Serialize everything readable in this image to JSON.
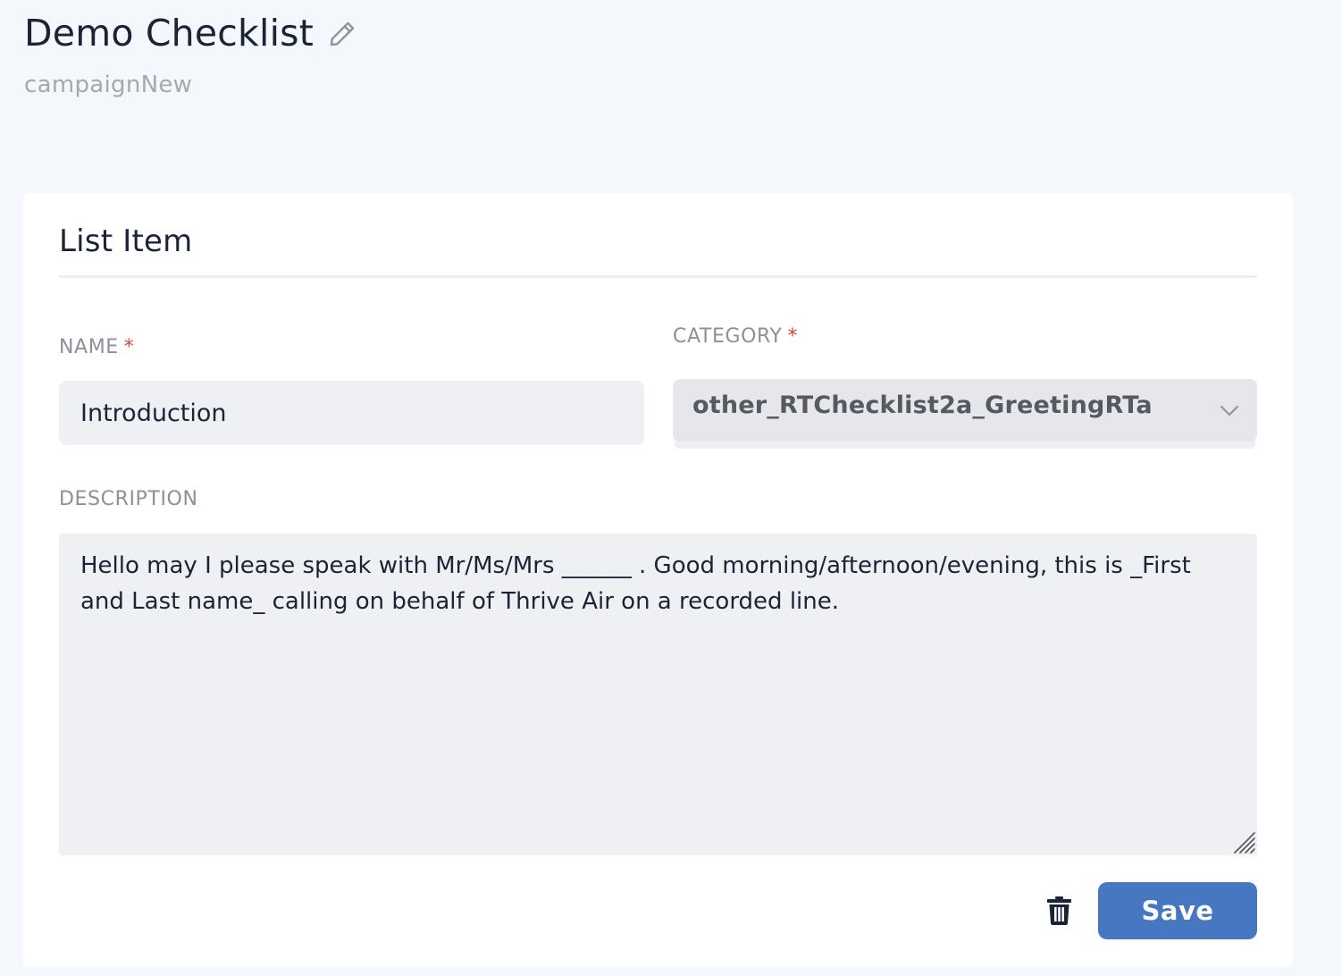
{
  "header": {
    "title": "Demo Checklist",
    "subtitle": "campaignNew",
    "edit_icon": "pencil-icon"
  },
  "card": {
    "title": "List Item",
    "fields": {
      "name": {
        "label": "NAME",
        "required_mark": "*",
        "value": "Introduction"
      },
      "category": {
        "label": "CATEGORY",
        "required_mark": "*",
        "selected": "other_RTChecklist2a_GreetingRTa",
        "icon": "chevron-down-icon"
      },
      "description": {
        "label": "DESCRIPTION",
        "value": "Hello may I please speak with Mr/Ms/Mrs ______ . Good morning/afternoon/evening, this is _First and Last name_ calling on behalf of Thrive Air on a recorded line."
      }
    },
    "actions": {
      "delete_icon": "trash-icon",
      "save_label": "Save"
    }
  },
  "colors": {
    "background": "#f4f7fb",
    "card": "#ffffff",
    "input_background": "#eff0f4",
    "accent": "#4677c0",
    "required": "#d64545",
    "label": "#8b9099"
  }
}
